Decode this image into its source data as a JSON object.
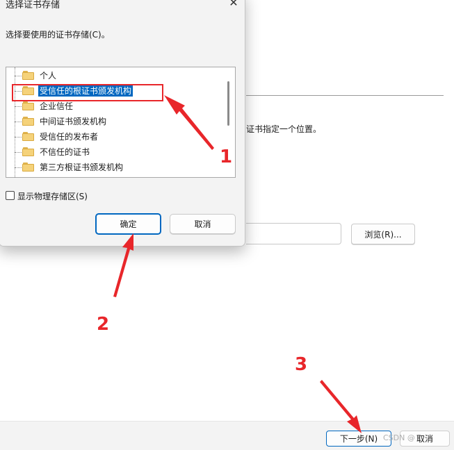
{
  "background_wizard": {
    "instruction_text": "证书指定一个位置。",
    "browse_label": "浏览(R)...",
    "next_label": "下一步(N)",
    "cancel_label": "取消"
  },
  "dialog": {
    "title": "选择证书存储",
    "close_glyph": "✕",
    "prompt": "选择要使用的证书存储(C)。",
    "stores": [
      {
        "label": "个人",
        "selected": false
      },
      {
        "label": "受信任的根证书颁发机构",
        "selected": true
      },
      {
        "label": "企业信任",
        "selected": false
      },
      {
        "label": "中间证书颁发机构",
        "selected": false
      },
      {
        "label": "受信任的发布者",
        "selected": false
      },
      {
        "label": "不信任的证书",
        "selected": false
      },
      {
        "label": "第三方根证书颁发机构",
        "selected": false
      }
    ],
    "show_physical_label": "显示物理存储区(S)",
    "show_physical_checked": false,
    "ok_label": "确定",
    "cancel_label": "取消"
  },
  "annotations": {
    "step1": "1",
    "step2": "2",
    "step3": "3",
    "color": "#e8262a"
  },
  "watermark": "CSDN @"
}
